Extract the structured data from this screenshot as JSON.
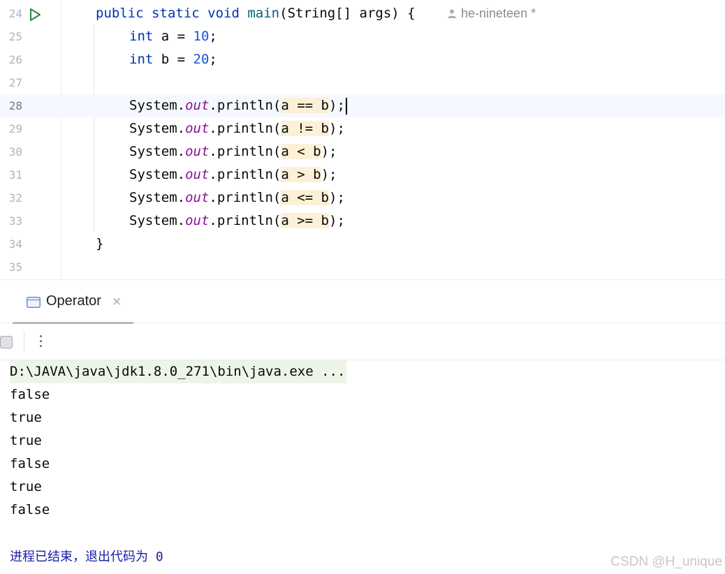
{
  "editor": {
    "author_label": "he-nineteen *",
    "lines": [
      {
        "num": "24",
        "tokens": [
          {
            "t": "public ",
            "c": "kw"
          },
          {
            "t": "static ",
            "c": "kw"
          },
          {
            "t": "void ",
            "c": "kw"
          },
          {
            "t": "main",
            "c": "fn"
          },
          {
            "t": "(String[] args) {",
            "c": ""
          }
        ]
      },
      {
        "num": "25",
        "tokens": [
          {
            "t": "int ",
            "c": "kw"
          },
          {
            "t": "a = ",
            "c": ""
          },
          {
            "t": "10",
            "c": "num"
          },
          {
            "t": ";",
            "c": ""
          }
        ]
      },
      {
        "num": "26",
        "tokens": [
          {
            "t": "int ",
            "c": "kw"
          },
          {
            "t": "b = ",
            "c": ""
          },
          {
            "t": "20",
            "c": "num"
          },
          {
            "t": ";",
            "c": ""
          }
        ]
      },
      {
        "num": "27",
        "tokens": []
      },
      {
        "num": "28",
        "tokens": [
          {
            "t": "System.",
            "c": ""
          },
          {
            "t": "out",
            "c": "fld"
          },
          {
            "t": ".println(",
            "c": ""
          },
          {
            "t": "a == b",
            "c": "hl"
          },
          {
            "t": ");",
            "c": ""
          }
        ]
      },
      {
        "num": "29",
        "tokens": [
          {
            "t": "System.",
            "c": ""
          },
          {
            "t": "out",
            "c": "fld"
          },
          {
            "t": ".println(",
            "c": ""
          },
          {
            "t": "a != b",
            "c": "hl"
          },
          {
            "t": ");",
            "c": ""
          }
        ]
      },
      {
        "num": "30",
        "tokens": [
          {
            "t": "System.",
            "c": ""
          },
          {
            "t": "out",
            "c": "fld"
          },
          {
            "t": ".println(",
            "c": ""
          },
          {
            "t": "a < b",
            "c": "hl"
          },
          {
            "t": ");",
            "c": ""
          }
        ]
      },
      {
        "num": "31",
        "tokens": [
          {
            "t": "System.",
            "c": ""
          },
          {
            "t": "out",
            "c": "fld"
          },
          {
            "t": ".println(",
            "c": ""
          },
          {
            "t": "a > b",
            "c": "hl"
          },
          {
            "t": ");",
            "c": ""
          }
        ]
      },
      {
        "num": "32",
        "tokens": [
          {
            "t": "System.",
            "c": ""
          },
          {
            "t": "out",
            "c": "fld"
          },
          {
            "t": ".println(",
            "c": ""
          },
          {
            "t": "a <= b",
            "c": "hl"
          },
          {
            "t": ");",
            "c": ""
          }
        ]
      },
      {
        "num": "33",
        "tokens": [
          {
            "t": "System.",
            "c": ""
          },
          {
            "t": "out",
            "c": "fld"
          },
          {
            "t": ".println(",
            "c": ""
          },
          {
            "t": "a >= b",
            "c": "hl"
          },
          {
            "t": ");",
            "c": ""
          }
        ]
      },
      {
        "num": "34",
        "tokens": [
          {
            "t": "}",
            "c": ""
          }
        ]
      },
      {
        "num": "35",
        "tokens": []
      }
    ]
  },
  "run_window": {
    "tab_label": "Operator",
    "tab_close": "×",
    "command": "D:\\JAVA\\java\\jdk1.8.0_271\\bin\\java.exe ...",
    "output": [
      "false",
      "true",
      "true",
      "false",
      "true",
      "false"
    ],
    "exit_message": "进程已结束，退出代码为 0"
  },
  "watermark": "CSDN @H_unique",
  "colors": {
    "keyword": "#0033b3",
    "method": "#00627a",
    "number": "#1750eb",
    "field": "#871094",
    "highlight": "#fcf1d6",
    "current_line": "#f5f8fe",
    "command_bg": "#edf5e9",
    "exit_text": "#1a1aa6",
    "run_icon": "#208a3c"
  }
}
